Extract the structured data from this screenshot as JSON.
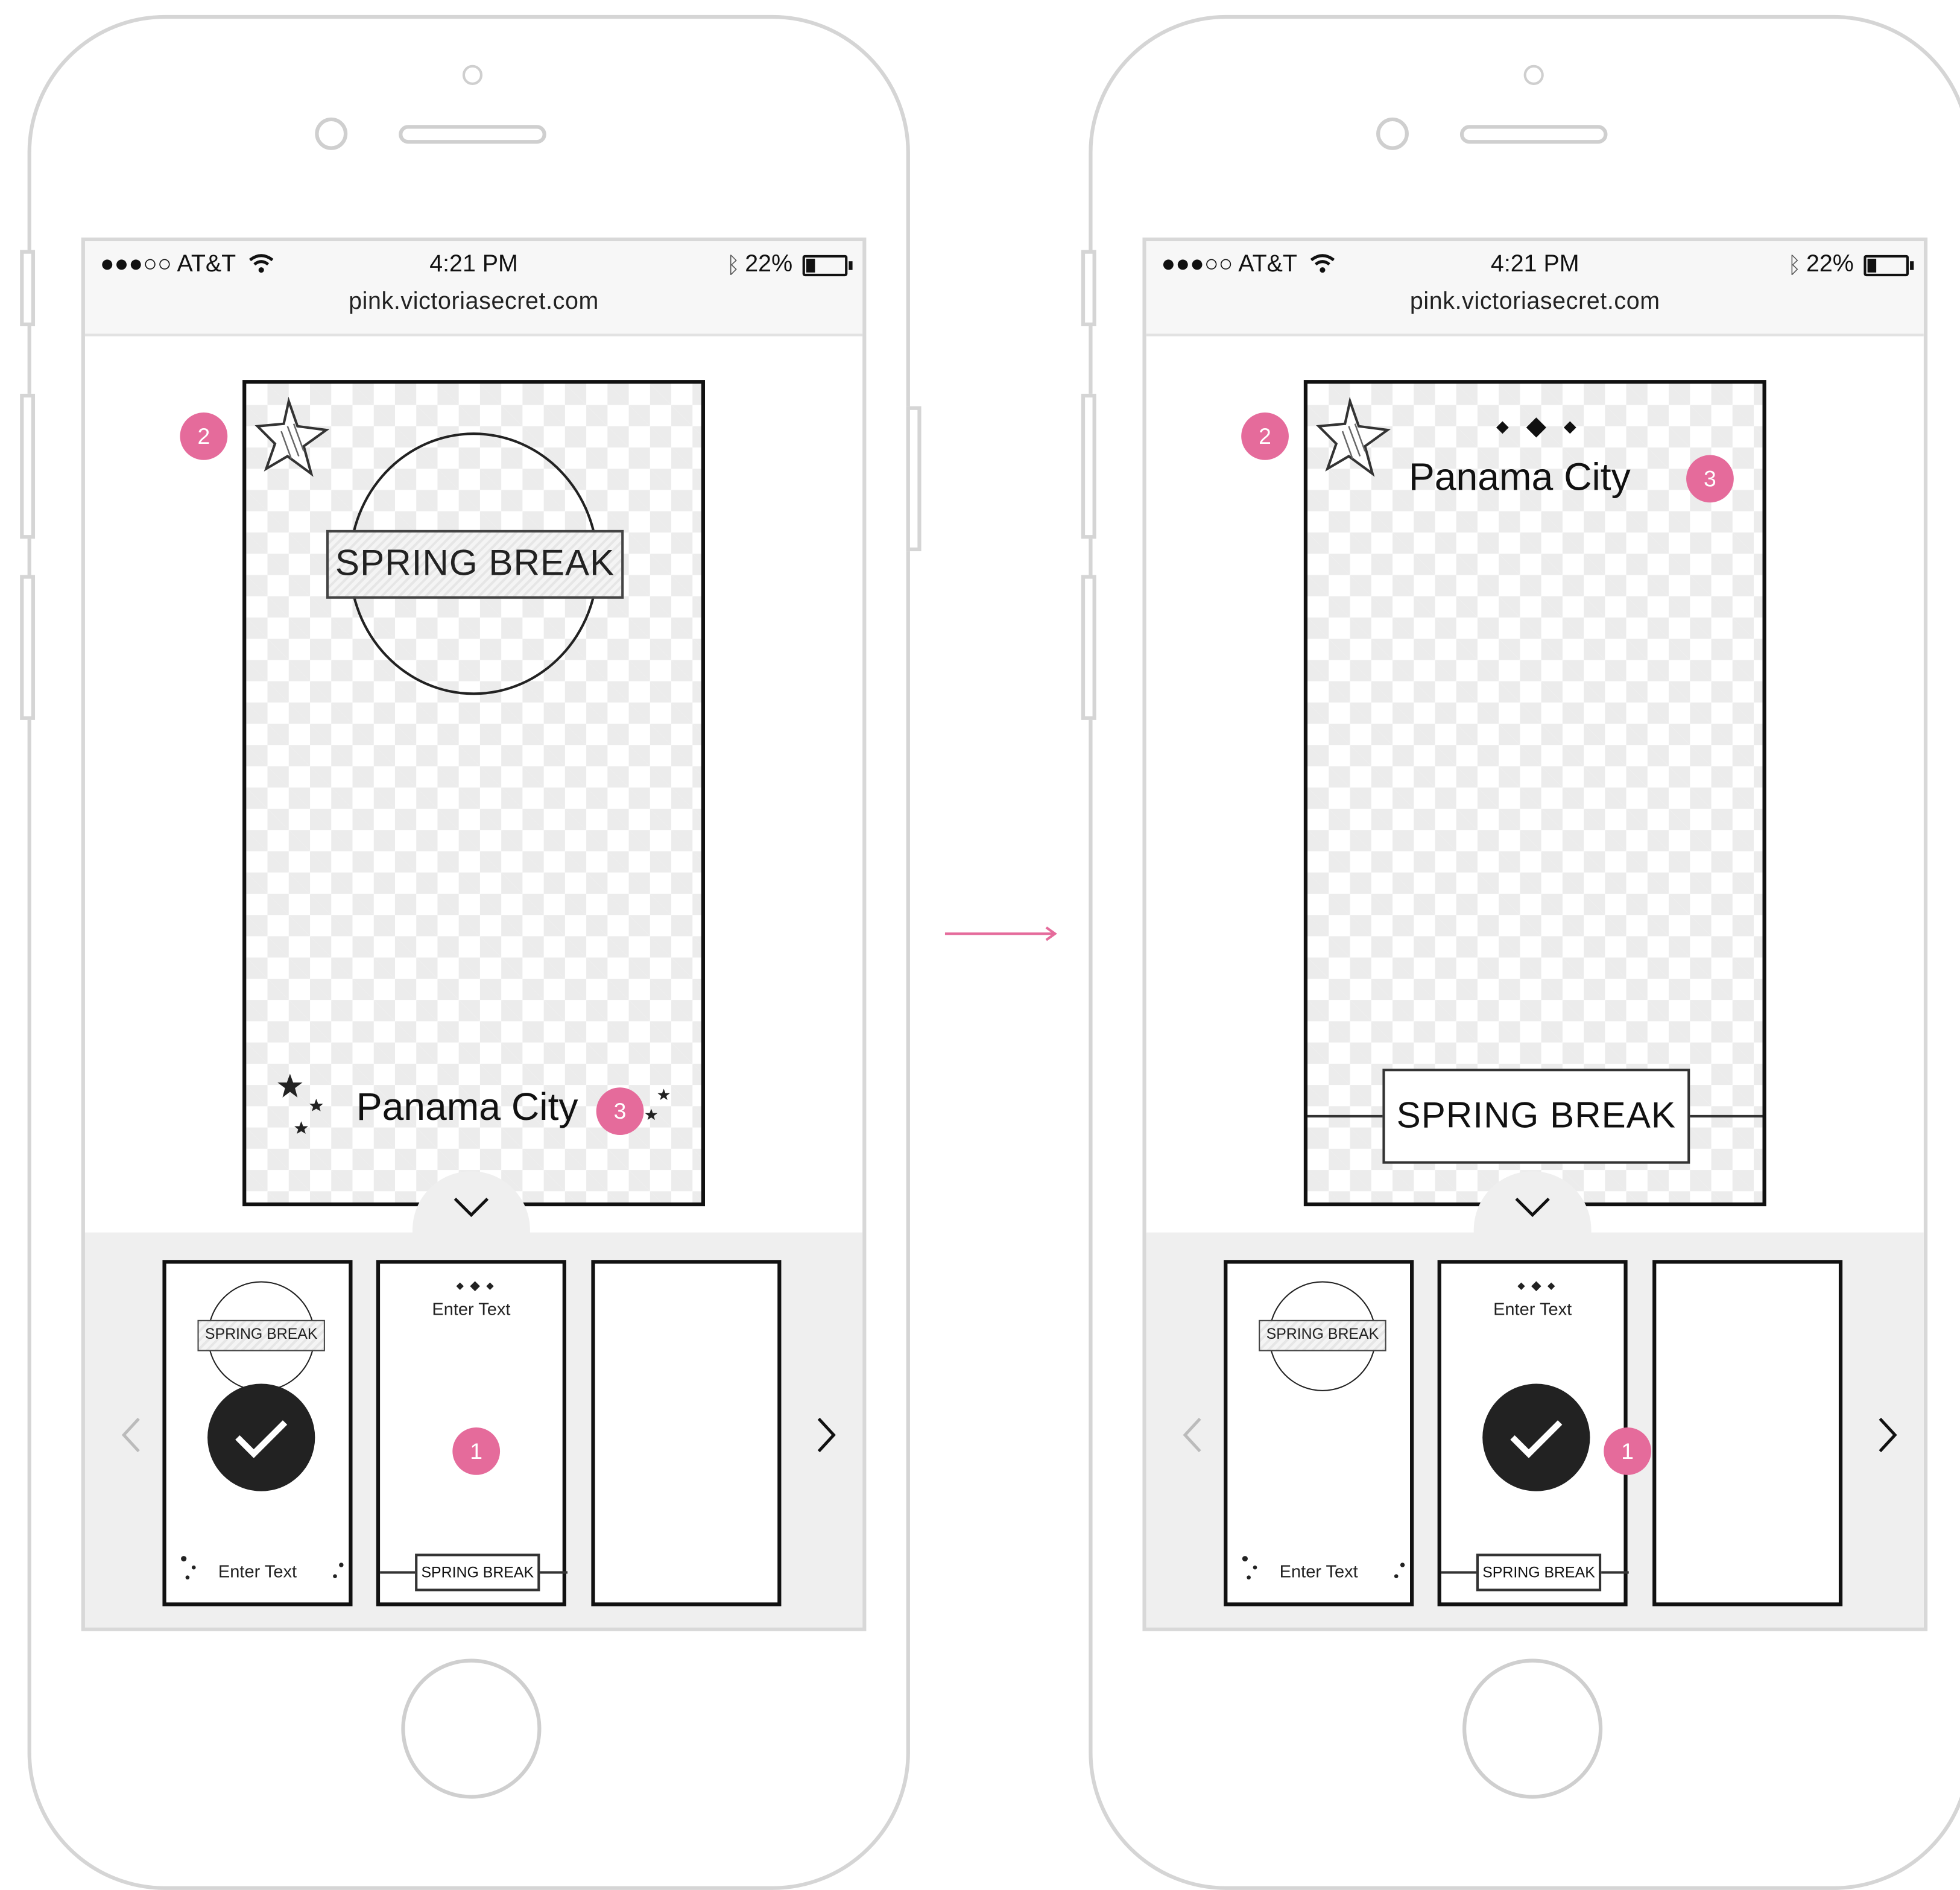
{
  "status_bar": {
    "carrier": "●●●○○ AT&T",
    "time": "4:21 PM",
    "battery": "22%",
    "battery_level": 0.22
  },
  "browser": {
    "url": "pink.victoriasecret.com"
  },
  "colors": {
    "accent_pink": "#e56b9b",
    "frame_gray": "#d5d5d5",
    "ink": "#111111"
  },
  "screens": [
    {
      "canvas": {
        "circle_banner": "SPRING BREAK",
        "city_text": "Panama City"
      },
      "callouts": {
        "sticker": "2",
        "text": "3",
        "template": "1"
      },
      "templates": [
        {
          "banner": "SPRING BREAK",
          "footer_text": "Enter Text",
          "selected": true
        },
        {
          "header_text": "Enter Text",
          "footer_banner": "SPRING BREAK",
          "selected": false
        },
        {
          "selected": false
        }
      ]
    },
    {
      "canvas": {
        "city_text": "Panama City",
        "bottom_banner": "SPRING BREAK"
      },
      "callouts": {
        "sticker": "2",
        "text": "3",
        "template": "1"
      },
      "templates": [
        {
          "banner": "SPRING BREAK",
          "footer_text": "Enter Text",
          "selected": false
        },
        {
          "header_text": "Enter Text",
          "footer_banner": "SPRING BREAK",
          "selected": true
        },
        {
          "selected": false
        }
      ]
    }
  ]
}
